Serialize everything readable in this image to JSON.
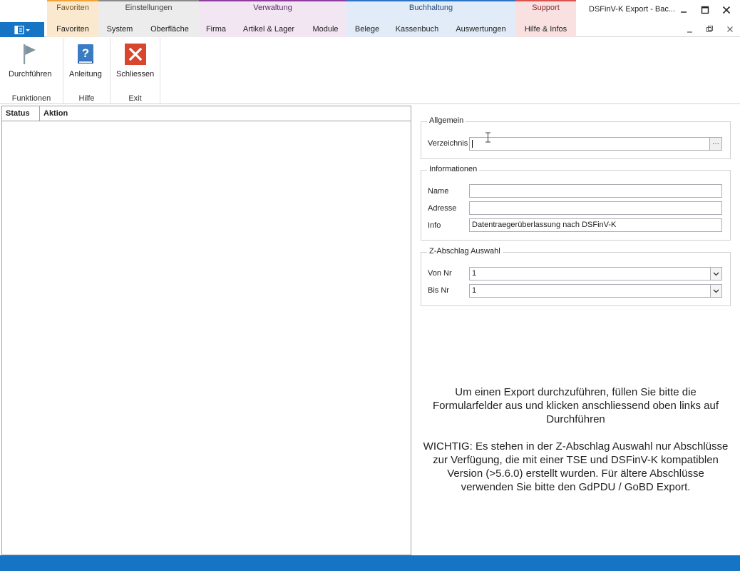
{
  "window": {
    "title": "DSFinV-K Export - Bac..."
  },
  "ribbon": {
    "groups": [
      {
        "caption": "Favoriten",
        "color": "#f5dfbf"
      },
      {
        "caption": "Einstellungen",
        "color": "#e2e2e2"
      },
      {
        "caption": "Verwaltung",
        "color": "#ecdcec"
      },
      {
        "caption": "Buchhaltung",
        "color": "#d8e6f5"
      },
      {
        "caption": "Support",
        "color": "#f5d4d4"
      }
    ],
    "tabs": [
      "Favoriten",
      "System",
      "Oberfläche",
      "Firma",
      "Artikel & Lager",
      "Module",
      "Belege",
      "Kassenbuch",
      "Auswertungen",
      "Hilfe & Infos"
    ]
  },
  "toolbar": {
    "run_label": "Durchführen",
    "help_label": "Anleitung",
    "close_label": "Schliessen",
    "group_functions": "Funktionen",
    "group_help": "Hilfe",
    "group_exit": "Exit"
  },
  "list": {
    "columns": [
      "Status",
      "Aktion"
    ]
  },
  "form": {
    "general": {
      "title": "Allgemein",
      "dir_label": "Verzeichnis",
      "dir_value": "",
      "dots_label": "···"
    },
    "info": {
      "title": "Informationen",
      "name_label": "Name",
      "name_value": "",
      "address_label": "Adresse",
      "address_value": "",
      "info_label": "Info",
      "info_value": "Datentraegerüberlassung nach DSFinV-K"
    },
    "zsel": {
      "title": "Z-Abschlag Auswahl",
      "from_label": "Von Nr",
      "from_value": "1",
      "to_label": "Bis Nr",
      "to_value": "1"
    }
  },
  "message": {
    "instruction": "Um einen Export durchzuführen, füllen Sie bitte die Formularfelder aus und klicken anschliessend oben links auf Durchführen",
    "important": "WICHTIG: Es stehen in der Z-Abschlag Auswahl nur Abschlüsse zur Verfügung, die mit einer TSE und DSFinV-K kompatiblen Version (>5.6.0) erstellt wurden. Für ältere Abschlüsse verwenden Sie bitte den GdPDU / GoBD Export."
  },
  "colors": {
    "accent": "#1574c4",
    "favoriten_bar": "#f2a33a",
    "einstellungen_bar": "#8a8a8a",
    "verwaltung_bar": "#8e3c9e",
    "buchhaltung_bar": "#2e74c4",
    "support_bar": "#d9534f",
    "close_icon": "#d8462e",
    "help_icon": "#3a7cc4"
  }
}
